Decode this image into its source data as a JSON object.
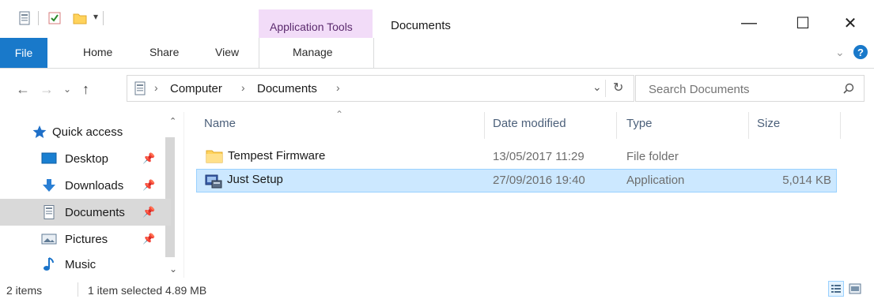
{
  "title_bar": {
    "contextual_tab": "Application Tools",
    "window_title": "Documents",
    "minimize": "—",
    "maximize": "☐",
    "close": "✕"
  },
  "ribbon": {
    "file": "File",
    "home": "Home",
    "share": "Share",
    "view": "View",
    "manage": "Manage"
  },
  "address": {
    "crumbs": [
      "Computer",
      "Documents"
    ],
    "separator": "›",
    "search_placeholder": "Search Documents"
  },
  "sidebar": {
    "items": [
      {
        "label": "Quick access",
        "icon": "star-icon",
        "color": "#1e6fc8"
      },
      {
        "label": "Desktop",
        "icon": "desktop-icon",
        "color": "#1a7fd1"
      },
      {
        "label": "Downloads",
        "icon": "download-arrow-icon",
        "color": "#2a7fd4"
      },
      {
        "label": "Documents",
        "icon": "documents-icon",
        "color": "#7a8a9a"
      },
      {
        "label": "Pictures",
        "icon": "pictures-icon",
        "color": "#5f7a94"
      },
      {
        "label": "Music",
        "icon": "music-note-icon",
        "color": "#1a73c9"
      }
    ],
    "selected": "Documents"
  },
  "file_list": {
    "columns": [
      "Name",
      "Date modified",
      "Type",
      "Size"
    ],
    "rows": [
      {
        "name": "Tempest Firmware",
        "date": "13/05/2017 11:29",
        "type": "File folder",
        "size": "",
        "icon": "folder-icon"
      },
      {
        "name": "Just Setup",
        "date": "27/09/2016 19:40",
        "type": "Application",
        "size": "5,014 KB",
        "icon": "application-icon",
        "selected": true
      }
    ]
  },
  "status_bar": {
    "item_count": "2 items",
    "selection": "1 item selected 4.89 MB"
  },
  "colors": {
    "accent": "#1979ca",
    "selection_bg": "#cce8ff",
    "selection_border": "#99d1ff",
    "contextual_tab_bg": "#f2dcf8",
    "nav_selected_bg": "#d9d9d9"
  }
}
